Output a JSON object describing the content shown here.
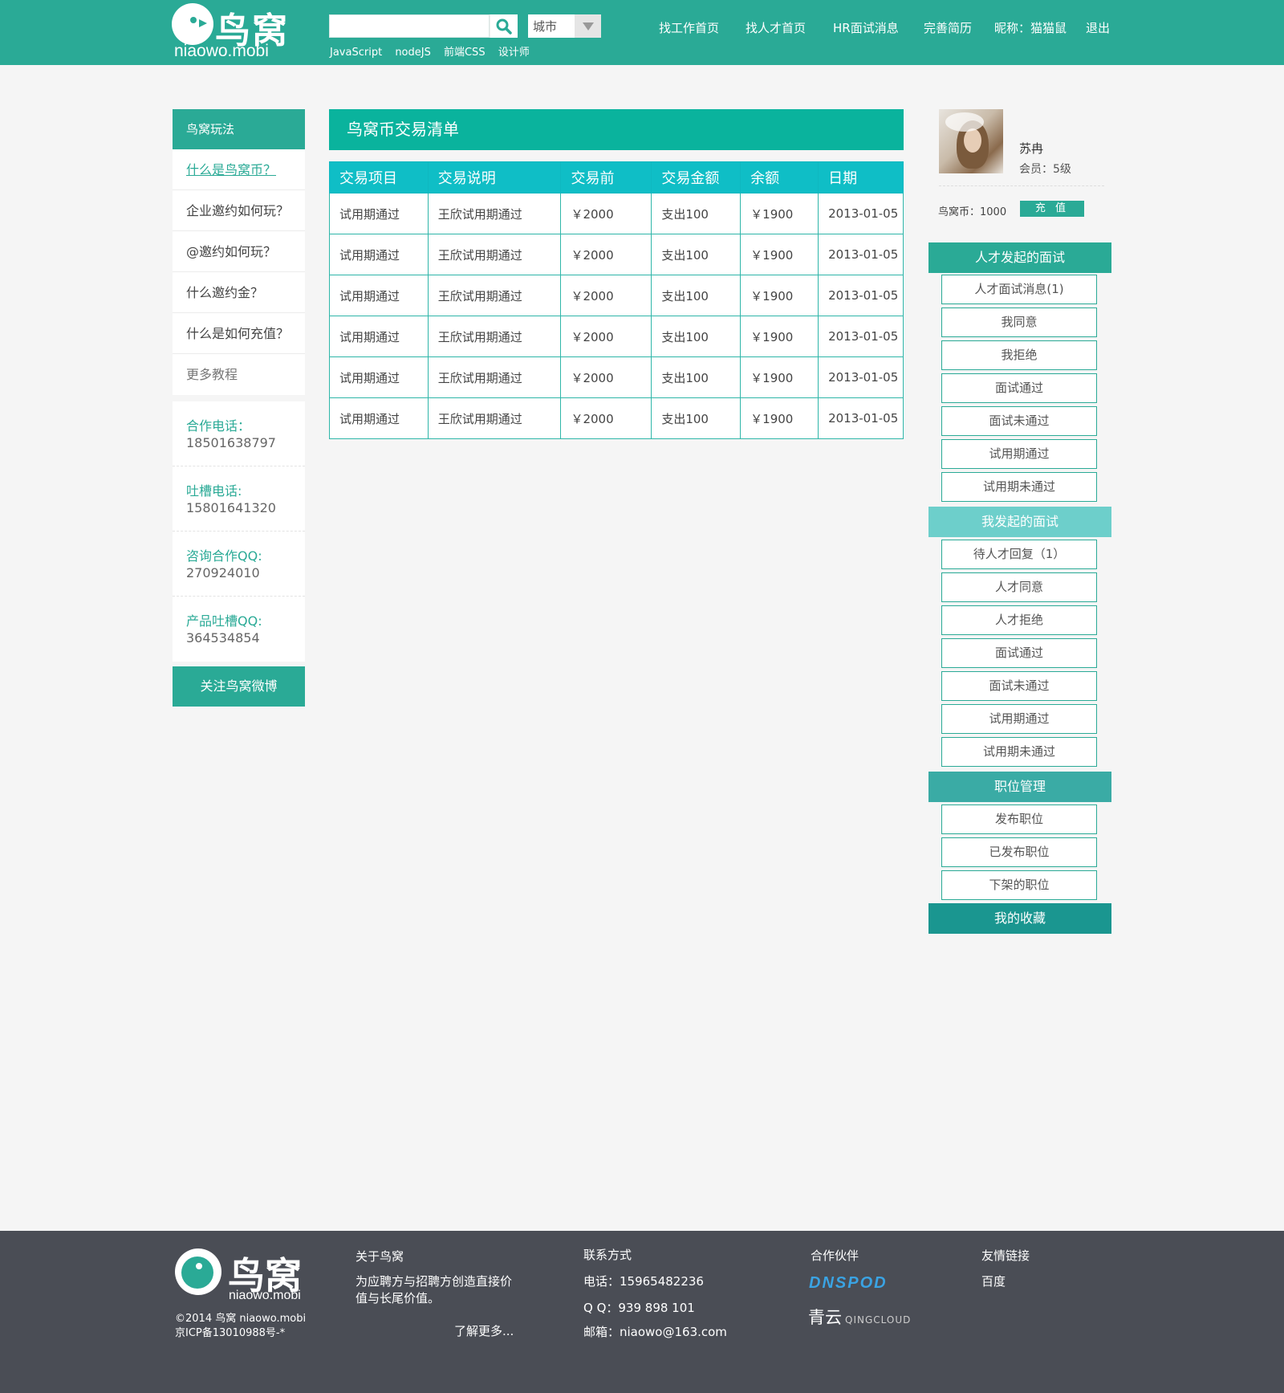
{
  "header": {
    "logo_cn": "鸟窝",
    "logo_en": "niaowo.mobi",
    "search_placeholder": "",
    "city_label": "城市",
    "hot_tags": [
      "JavaScript",
      "nodeJS",
      "前端CSS",
      "设计师"
    ],
    "nav": [
      "找工作首页",
      "找人才首页",
      "HR面试消息",
      "完善简历",
      "昵称：猫猫鼠",
      "退出"
    ]
  },
  "left": {
    "title": "鸟窝玩法",
    "items": [
      "什么是鸟窝币？",
      "企业邀约如何玩？",
      "@邀约如何玩？",
      "什么邀约金？",
      "什么是如何充值？"
    ],
    "more": "更多教程",
    "contacts": [
      {
        "label": "合作电话：",
        "value": "18501638797"
      },
      {
        "label": "吐槽电话:",
        "value": "15801641320"
      },
      {
        "label": "咨询合作QQ:",
        "value": "270924010"
      },
      {
        "label": "产品吐槽QQ:",
        "value": "364534854"
      }
    ],
    "follow": "关注鸟窝微博"
  },
  "main": {
    "title": "鸟窝币交易清单",
    "columns": [
      "交易项目",
      "交易说明",
      "交易前",
      "交易金额",
      "余额",
      "日期"
    ],
    "rows": [
      [
        "试用期通过",
        "王欣试用期通过",
        "￥2000",
        "支出100",
        "￥1900",
        "2013-01-05"
      ],
      [
        "试用期通过",
        "王欣试用期通过",
        "￥2000",
        "支出100",
        "￥1900",
        "2013-01-05"
      ],
      [
        "试用期通过",
        "王欣试用期通过",
        "￥2000",
        "支出100",
        "￥1900",
        "2013-01-05"
      ],
      [
        "试用期通过",
        "王欣试用期通过",
        "￥2000",
        "支出100",
        "￥1900",
        "2013-01-05"
      ],
      [
        "试用期通过",
        "王欣试用期通过",
        "￥2000",
        "支出100",
        "￥1900",
        "2013-01-05"
      ],
      [
        "试用期通过",
        "王欣试用期通过",
        "￥2000",
        "支出100",
        "￥1900",
        "2013-01-05"
      ]
    ]
  },
  "profile": {
    "name": "苏冉",
    "level": "会员：5级",
    "coins": "鸟窝币：1000",
    "recharge": "充 值"
  },
  "right": {
    "talent_title": "人才发起的面试",
    "talent_items": [
      "人才面试消息(1)",
      "我同意",
      "我拒绝",
      "面试通过",
      "面试未通过",
      "试用期通过",
      "试用期未通过"
    ],
    "mine_title": "我发起的面试",
    "mine_items": [
      "待人才回复（1）",
      "人才同意",
      "人才拒绝",
      "面试通过",
      "面试未通过",
      "试用期通过",
      "试用期未通过"
    ],
    "job_title": "职位管理",
    "job_items": [
      "发布职位",
      "已发布职位",
      "下架的职位"
    ],
    "fav_title": "我的收藏",
    "colors": {
      "section": "#2aaa96",
      "section_light": "#6dcfcb",
      "section_dark": "#1a9690"
    }
  },
  "footer": {
    "logo_cn": "鸟窝",
    "logo_en": "niaowo.mobi",
    "copyright": "©2014 鸟窝 niaowo.mobi",
    "icp": "京ICP备13010988号-*",
    "about_title": "关于鸟窝",
    "about_text": "为应聘方与招聘方创造直接价值与长尾价值。",
    "about_more": "了解更多...",
    "contact_title": "联系方式",
    "phone": "电话：15965482236",
    "qq": "Q Q：939 898 101",
    "email": "邮箱：niaowo@163.com",
    "partners_title": "合作伙伴",
    "partner_1": "DNSPOD",
    "partner_2_cn": "青云",
    "partner_2_en": "QINGCLOUD",
    "links_title": "友情链接",
    "link_1": "百度"
  }
}
